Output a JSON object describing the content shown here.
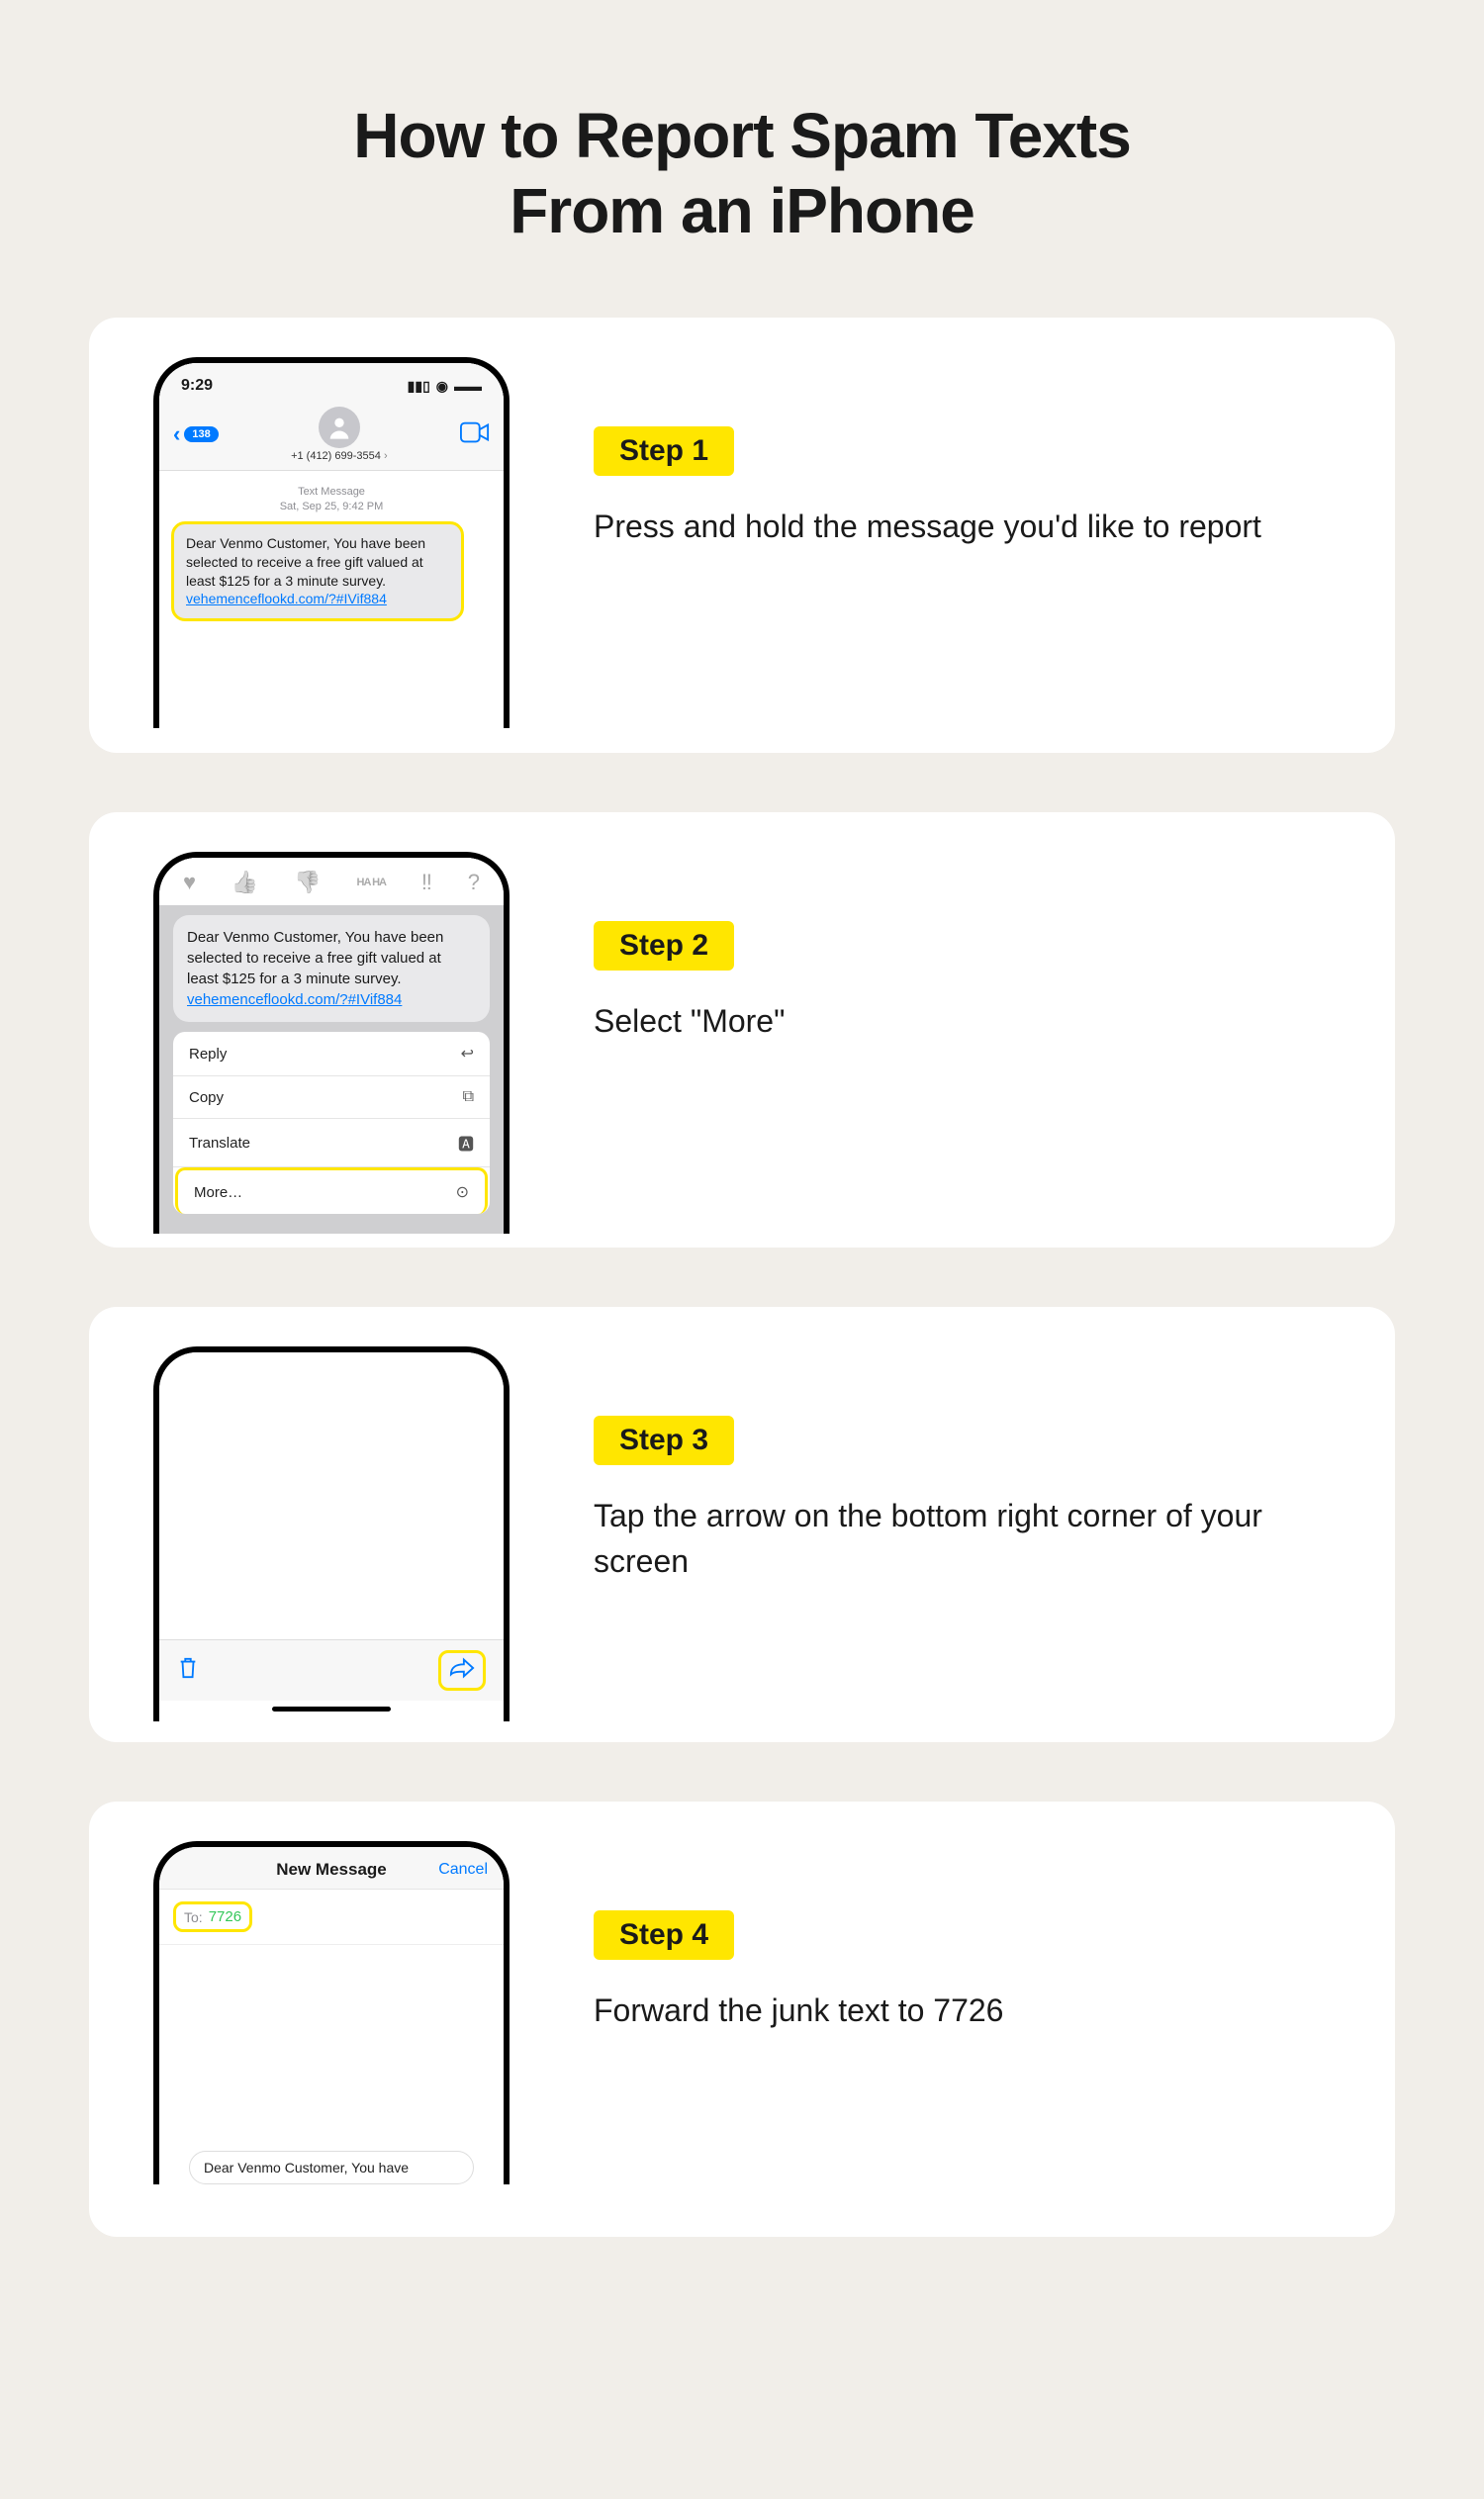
{
  "title_line1": "How to Report Spam Texts",
  "title_line2": "From an iPhone",
  "steps": [
    {
      "badge": "Step 1",
      "desc": "Press and hold the message you'd like to report"
    },
    {
      "badge": "Step 2",
      "desc": "Select \"More\""
    },
    {
      "badge": "Step 3",
      "desc": "Tap the arrow on the bottom right corner of your screen"
    },
    {
      "badge": "Step 4",
      "desc": "Forward the junk text to 7726"
    }
  ],
  "phone": {
    "time": "9:29",
    "back_count": "138",
    "sender_number": "+1 (412) 699-3554",
    "meta_line1": "Text Message",
    "meta_line2": "Sat, Sep 25, 9:42 PM",
    "bubble_text": "Dear Venmo Customer, You have been selected to receive a free gift valued at least $125 for a 3 minute survey.",
    "bubble_link": "vehemenceflookd.com/?#IVif884"
  },
  "tapbacks": [
    "♥",
    "👍",
    "👎",
    "HA HA",
    "‼",
    "?"
  ],
  "context_menu": [
    {
      "label": "Reply",
      "icon": "↩"
    },
    {
      "label": "Copy",
      "icon": "⧉"
    },
    {
      "label": "Translate",
      "icon": "🅰"
    },
    {
      "label": "More…",
      "icon": "⊙"
    }
  ],
  "newmsg": {
    "title": "New Message",
    "cancel": "Cancel",
    "to_label": "To:",
    "to_value": "7726",
    "compose_preview": "Dear Venmo Customer, You have"
  }
}
